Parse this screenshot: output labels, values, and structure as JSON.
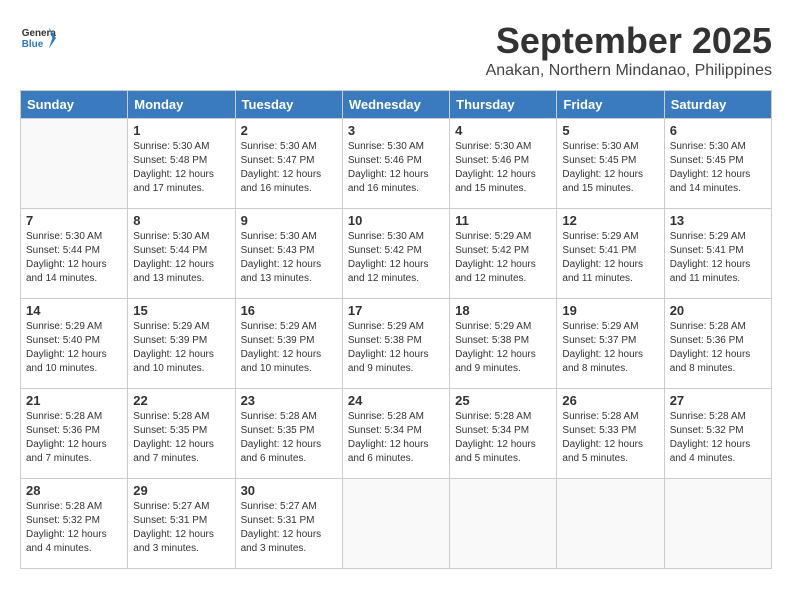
{
  "header": {
    "logo_general": "General",
    "logo_blue": "Blue",
    "month": "September 2025",
    "location": "Anakan, Northern Mindanao, Philippines"
  },
  "weekdays": [
    "Sunday",
    "Monday",
    "Tuesday",
    "Wednesday",
    "Thursday",
    "Friday",
    "Saturday"
  ],
  "weeks": [
    [
      {
        "day": "",
        "info": ""
      },
      {
        "day": "1",
        "info": "Sunrise: 5:30 AM\nSunset: 5:48 PM\nDaylight: 12 hours\nand 17 minutes."
      },
      {
        "day": "2",
        "info": "Sunrise: 5:30 AM\nSunset: 5:47 PM\nDaylight: 12 hours\nand 16 minutes."
      },
      {
        "day": "3",
        "info": "Sunrise: 5:30 AM\nSunset: 5:46 PM\nDaylight: 12 hours\nand 16 minutes."
      },
      {
        "day": "4",
        "info": "Sunrise: 5:30 AM\nSunset: 5:46 PM\nDaylight: 12 hours\nand 15 minutes."
      },
      {
        "day": "5",
        "info": "Sunrise: 5:30 AM\nSunset: 5:45 PM\nDaylight: 12 hours\nand 15 minutes."
      },
      {
        "day": "6",
        "info": "Sunrise: 5:30 AM\nSunset: 5:45 PM\nDaylight: 12 hours\nand 14 minutes."
      }
    ],
    [
      {
        "day": "7",
        "info": "Sunrise: 5:30 AM\nSunset: 5:44 PM\nDaylight: 12 hours\nand 14 minutes."
      },
      {
        "day": "8",
        "info": "Sunrise: 5:30 AM\nSunset: 5:44 PM\nDaylight: 12 hours\nand 13 minutes."
      },
      {
        "day": "9",
        "info": "Sunrise: 5:30 AM\nSunset: 5:43 PM\nDaylight: 12 hours\nand 13 minutes."
      },
      {
        "day": "10",
        "info": "Sunrise: 5:30 AM\nSunset: 5:42 PM\nDaylight: 12 hours\nand 12 minutes."
      },
      {
        "day": "11",
        "info": "Sunrise: 5:29 AM\nSunset: 5:42 PM\nDaylight: 12 hours\nand 12 minutes."
      },
      {
        "day": "12",
        "info": "Sunrise: 5:29 AM\nSunset: 5:41 PM\nDaylight: 12 hours\nand 11 minutes."
      },
      {
        "day": "13",
        "info": "Sunrise: 5:29 AM\nSunset: 5:41 PM\nDaylight: 12 hours\nand 11 minutes."
      }
    ],
    [
      {
        "day": "14",
        "info": "Sunrise: 5:29 AM\nSunset: 5:40 PM\nDaylight: 12 hours\nand 10 minutes."
      },
      {
        "day": "15",
        "info": "Sunrise: 5:29 AM\nSunset: 5:39 PM\nDaylight: 12 hours\nand 10 minutes."
      },
      {
        "day": "16",
        "info": "Sunrise: 5:29 AM\nSunset: 5:39 PM\nDaylight: 12 hours\nand 10 minutes."
      },
      {
        "day": "17",
        "info": "Sunrise: 5:29 AM\nSunset: 5:38 PM\nDaylight: 12 hours\nand 9 minutes."
      },
      {
        "day": "18",
        "info": "Sunrise: 5:29 AM\nSunset: 5:38 PM\nDaylight: 12 hours\nand 9 minutes."
      },
      {
        "day": "19",
        "info": "Sunrise: 5:29 AM\nSunset: 5:37 PM\nDaylight: 12 hours\nand 8 minutes."
      },
      {
        "day": "20",
        "info": "Sunrise: 5:28 AM\nSunset: 5:36 PM\nDaylight: 12 hours\nand 8 minutes."
      }
    ],
    [
      {
        "day": "21",
        "info": "Sunrise: 5:28 AM\nSunset: 5:36 PM\nDaylight: 12 hours\nand 7 minutes."
      },
      {
        "day": "22",
        "info": "Sunrise: 5:28 AM\nSunset: 5:35 PM\nDaylight: 12 hours\nand 7 minutes."
      },
      {
        "day": "23",
        "info": "Sunrise: 5:28 AM\nSunset: 5:35 PM\nDaylight: 12 hours\nand 6 minutes."
      },
      {
        "day": "24",
        "info": "Sunrise: 5:28 AM\nSunset: 5:34 PM\nDaylight: 12 hours\nand 6 minutes."
      },
      {
        "day": "25",
        "info": "Sunrise: 5:28 AM\nSunset: 5:34 PM\nDaylight: 12 hours\nand 5 minutes."
      },
      {
        "day": "26",
        "info": "Sunrise: 5:28 AM\nSunset: 5:33 PM\nDaylight: 12 hours\nand 5 minutes."
      },
      {
        "day": "27",
        "info": "Sunrise: 5:28 AM\nSunset: 5:32 PM\nDaylight: 12 hours\nand 4 minutes."
      }
    ],
    [
      {
        "day": "28",
        "info": "Sunrise: 5:28 AM\nSunset: 5:32 PM\nDaylight: 12 hours\nand 4 minutes."
      },
      {
        "day": "29",
        "info": "Sunrise: 5:27 AM\nSunset: 5:31 PM\nDaylight: 12 hours\nand 3 minutes."
      },
      {
        "day": "30",
        "info": "Sunrise: 5:27 AM\nSunset: 5:31 PM\nDaylight: 12 hours\nand 3 minutes."
      },
      {
        "day": "",
        "info": ""
      },
      {
        "day": "",
        "info": ""
      },
      {
        "day": "",
        "info": ""
      },
      {
        "day": "",
        "info": ""
      }
    ]
  ]
}
